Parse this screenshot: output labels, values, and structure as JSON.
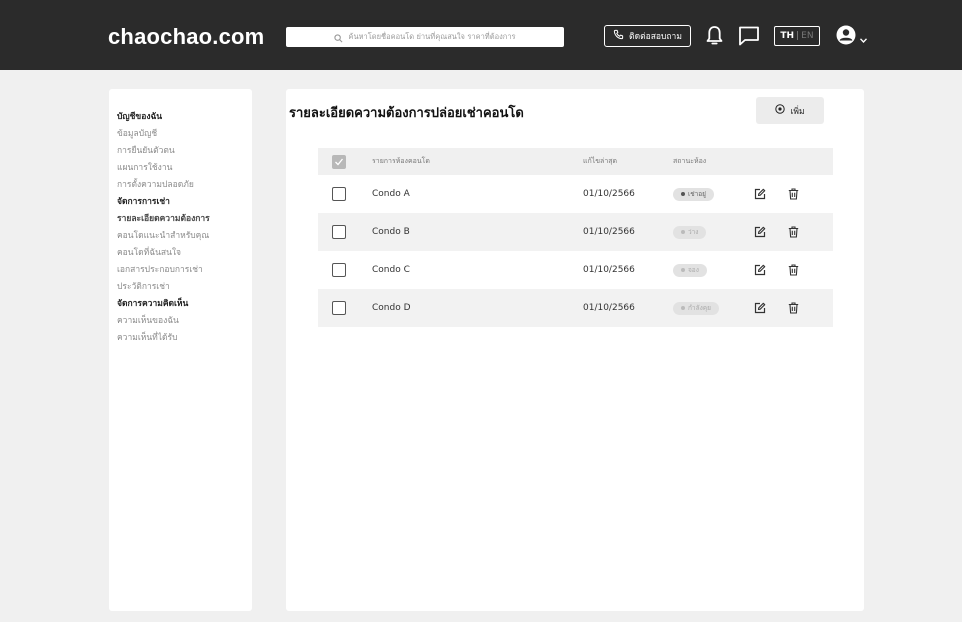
{
  "header": {
    "logo": "chaochao.com",
    "search_placeholder": "ค้นหาโดยชื่อคอนโด ย่านที่คุณสนใจ ราคาที่ต้องการ",
    "contact_label": "ติดต่อสอบถาม",
    "lang_th": "TH",
    "lang_sep": "|",
    "lang_en": "EN"
  },
  "sidebar": {
    "items": [
      {
        "label": "บัญชีของฉัน",
        "style": "head"
      },
      {
        "label": "ข้อมูลบัญชี",
        "style": "normal"
      },
      {
        "label": "การยืนยันตัวตน",
        "style": "normal"
      },
      {
        "label": "แผนการใช้งาน",
        "style": "normal"
      },
      {
        "label": "การตั้งความปลอดภัย",
        "style": "normal"
      },
      {
        "label": "จัดการการเช่า",
        "style": "head"
      },
      {
        "label": "รายละเอียดความต้องการ",
        "style": "active"
      },
      {
        "label": "คอนโดแนะนำสำหรับคุณ",
        "style": "normal"
      },
      {
        "label": "คอนโดที่ฉันสนใจ",
        "style": "normal"
      },
      {
        "label": "เอกสารประกอบการเช่า",
        "style": "normal"
      },
      {
        "label": "ประวัติการเช่า",
        "style": "normal"
      },
      {
        "label": "จัดการความคิดเห็น",
        "style": "head"
      },
      {
        "label": "ความเห็นของฉัน",
        "style": "normal"
      },
      {
        "label": "ความเห็นที่ได้รับ",
        "style": "normal"
      }
    ]
  },
  "main": {
    "title": "รายละเอียดความต้องการปล่อยเช่าคอนโด",
    "add_label": "เพิ่ม",
    "columns": {
      "name": "รายการห้องคอนโด",
      "updated": "แก้ไขล่าสุด",
      "status": "สถานะห้อง"
    },
    "rows": [
      {
        "name": "Condo A",
        "updated": "01/10/2566",
        "status": "เช่าอยู่",
        "status_tone": "dark"
      },
      {
        "name": "Condo B",
        "updated": "01/10/2566",
        "status": "ว่าง",
        "status_tone": "light"
      },
      {
        "name": "Condo C",
        "updated": "01/10/2566",
        "status": "จอง",
        "status_tone": "light"
      },
      {
        "name": "Condo D",
        "updated": "01/10/2566",
        "status": "กำลังคุย",
        "status_tone": "light"
      }
    ]
  },
  "icons": {
    "search": "search-icon",
    "phone": "phone-icon",
    "bell": "bell-icon",
    "chat": "chat-icon",
    "profile": "user-circle-icon",
    "add": "plus-circle-icon",
    "edit": "edit-icon",
    "delete": "trash-icon"
  },
  "colors": {
    "topbar": "#2b2b2b",
    "background": "#f0f0f0",
    "panel": "#ffffff"
  }
}
